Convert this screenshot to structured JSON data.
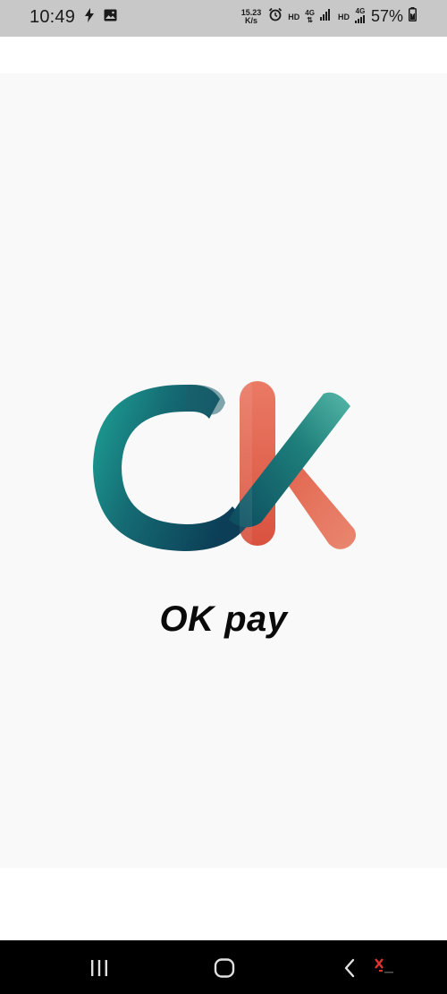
{
  "status_bar": {
    "time": "10:49",
    "net_speed_value": "15.23",
    "net_speed_unit": "K/s",
    "hd_label_1": "HD",
    "network_label_1": "4G",
    "hd_label_2": "HD",
    "network_label_2": "4G",
    "battery": "57%",
    "icons": [
      "flash-icon",
      "image-icon",
      "alarm-icon",
      "signal-icon",
      "signal-icon",
      "battery-icon"
    ]
  },
  "splash": {
    "app_name": "OK pay",
    "logo_icon": "ok-logo-icon"
  },
  "nav_bar": {
    "buttons": [
      "recent-apps",
      "home",
      "back"
    ]
  },
  "colors": {
    "status_bar_bg": "#c8c8c8",
    "splash_bg": "#f9f9f9",
    "teal": "#1f8a83",
    "dark_teal": "#0d4a5c",
    "coral": "#e0604b",
    "nav_bg": "#000000"
  }
}
